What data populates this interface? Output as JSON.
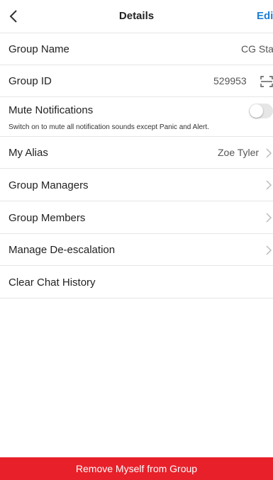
{
  "header": {
    "title": "Details",
    "edit_label": "Edit"
  },
  "rows": {
    "group_name": {
      "label": "Group Name",
      "value": "CG Staff"
    },
    "group_id": {
      "label": "Group ID",
      "value": "529953"
    },
    "mute": {
      "label": "Mute Notifications",
      "subtext": "Switch on to mute all notification sounds except Panic and Alert.",
      "enabled": false
    },
    "alias": {
      "label": "My Alias",
      "value": "Zoe Tyler"
    },
    "managers": {
      "label": "Group Managers"
    },
    "members": {
      "label": "Group Members"
    },
    "deescalation": {
      "label": "Manage De-escalation"
    },
    "clear": {
      "label": "Clear Chat History"
    }
  },
  "footer": {
    "remove_label": "Remove Myself from Group"
  },
  "colors": {
    "accent": "#1f7fd6",
    "danger": "#e8202a"
  },
  "icons": [
    "back-icon",
    "scan-icon",
    "chevron-right-icon"
  ]
}
